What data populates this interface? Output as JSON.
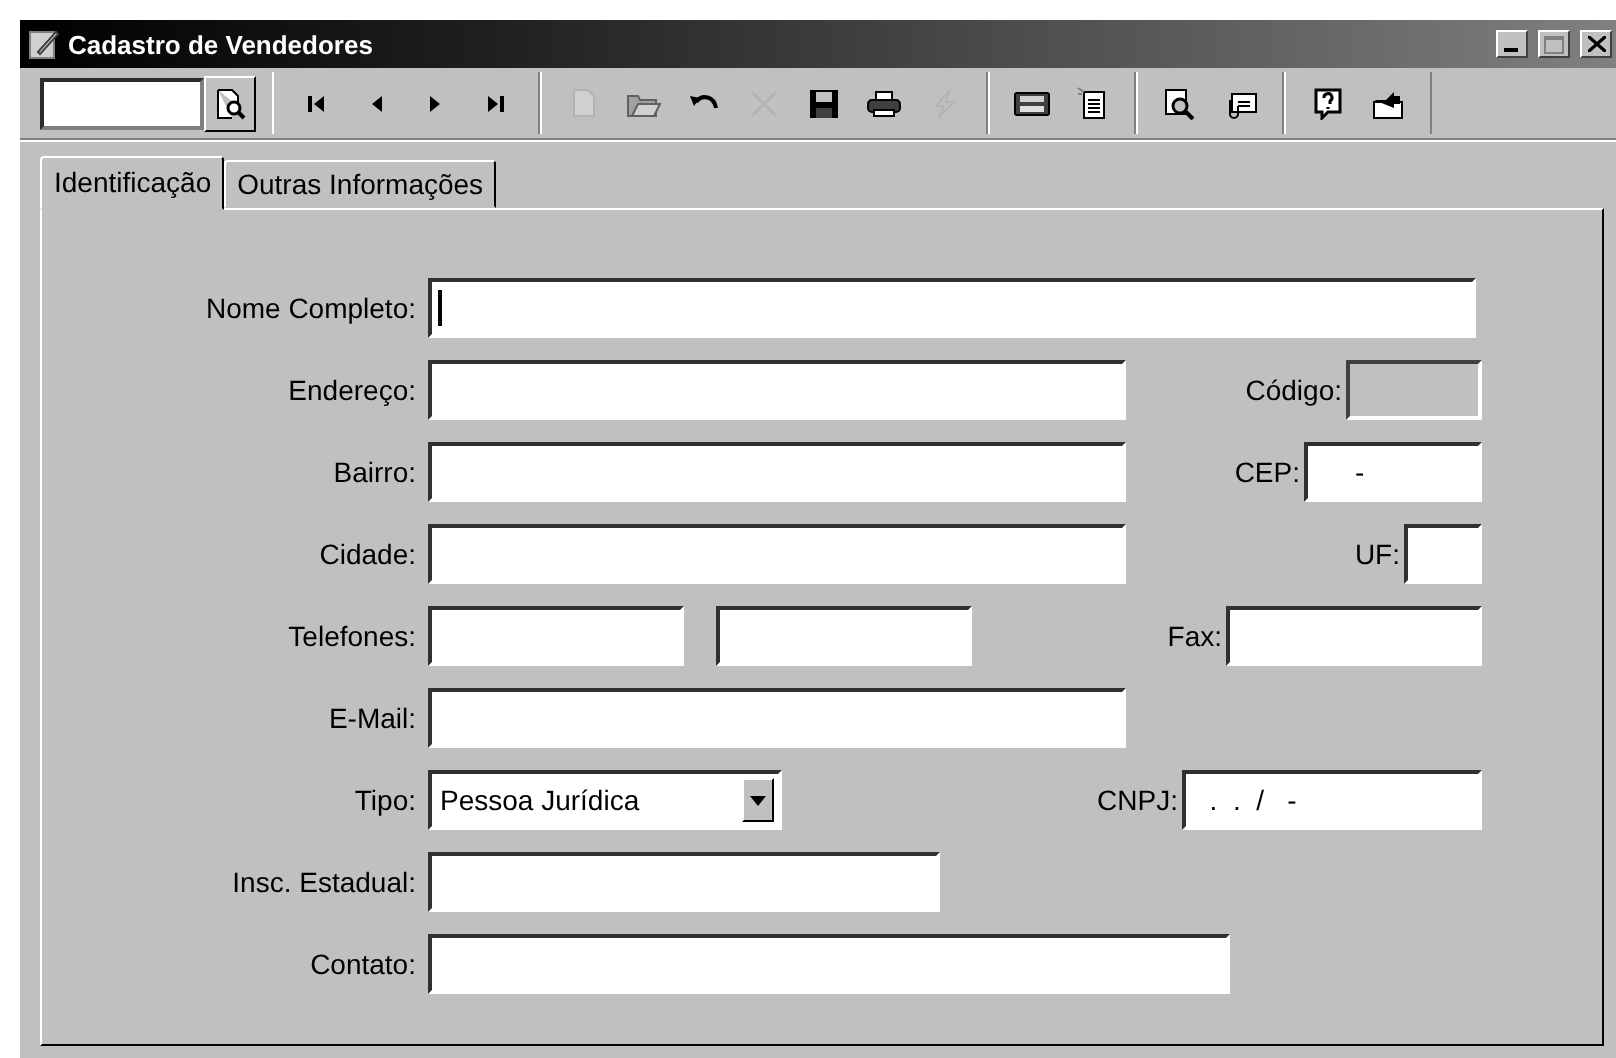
{
  "window": {
    "title": "Cadastro de Vendedores",
    "controls": [
      {
        "kind": "minimize",
        "disabled": false
      },
      {
        "kind": "maximize",
        "disabled": true
      },
      {
        "kind": "close",
        "disabled": false
      }
    ]
  },
  "toolbar": {
    "groups": [
      {
        "items": [
          {
            "kind": "search-input"
          },
          {
            "kind": "find",
            "disabled": false
          }
        ]
      },
      {
        "items": [
          {
            "kind": "first",
            "disabled": false
          },
          {
            "kind": "prev",
            "disabled": false
          },
          {
            "kind": "next",
            "disabled": false
          },
          {
            "kind": "last",
            "disabled": false
          }
        ]
      },
      {
        "items": [
          {
            "kind": "new",
            "disabled": true
          },
          {
            "kind": "open",
            "disabled": false
          },
          {
            "kind": "undo",
            "disabled": false
          },
          {
            "kind": "delete",
            "disabled": true
          },
          {
            "kind": "save",
            "disabled": false
          },
          {
            "kind": "print",
            "disabled": false
          },
          {
            "kind": "bolt",
            "disabled": true
          }
        ]
      },
      {
        "items": [
          {
            "kind": "calculator",
            "disabled": false
          },
          {
            "kind": "notepad",
            "disabled": false
          }
        ]
      },
      {
        "items": [
          {
            "kind": "preview",
            "disabled": false
          },
          {
            "kind": "attach",
            "disabled": false
          }
        ]
      },
      {
        "items": [
          {
            "kind": "help",
            "disabled": false
          },
          {
            "kind": "exit",
            "disabled": false
          }
        ]
      }
    ]
  },
  "tabs": [
    {
      "label": "Identificação",
      "selected": true
    },
    {
      "label": "Outras Informações",
      "selected": false
    }
  ],
  "form": {
    "rows": [
      {
        "fields": [
          {
            "label": "Nome Completo:",
            "kind": "text",
            "focused": true,
            "disabled": false
          }
        ]
      },
      {
        "fields": [
          {
            "label": "Endereço:",
            "kind": "text",
            "focused": false,
            "disabled": false
          },
          {
            "label": "Código:",
            "kind": "text",
            "focused": false,
            "disabled": true
          }
        ]
      },
      {
        "fields": [
          {
            "label": "Bairro:",
            "kind": "text",
            "focused": false,
            "disabled": false
          },
          {
            "label": "CEP:",
            "kind": "text",
            "value": "     -",
            "focused": false,
            "disabled": false
          }
        ]
      },
      {
        "fields": [
          {
            "label": "Cidade:",
            "kind": "text",
            "focused": false,
            "disabled": false
          },
          {
            "label": "UF:",
            "kind": "text",
            "focused": false,
            "disabled": false
          }
        ]
      },
      {
        "fields": [
          {
            "label": "Telefones:",
            "kind": "text",
            "focused": false,
            "disabled": false
          },
          {
            "kind": "text",
            "focused": false,
            "disabled": false
          },
          {
            "label": "Fax:",
            "kind": "text",
            "focused": false,
            "disabled": false
          }
        ]
      },
      {
        "fields": [
          {
            "label": "E-Mail:",
            "kind": "text",
            "focused": false,
            "disabled": false
          }
        ]
      },
      {
        "fields": [
          {
            "label": "Tipo:",
            "kind": "select",
            "value": "Pessoa Jurídica",
            "focused": false,
            "disabled": false
          },
          {
            "label": "CNPJ:",
            "kind": "text",
            "value": "  .  .  /   -",
            "focused": false,
            "disabled": false
          }
        ]
      },
      {
        "fields": [
          {
            "label": "Insc. Estadual:",
            "kind": "text",
            "focused": false,
            "disabled": false
          }
        ]
      },
      {
        "fields": [
          {
            "label": "Contato:",
            "kind": "text",
            "focused": false,
            "disabled": false
          }
        ]
      }
    ]
  }
}
